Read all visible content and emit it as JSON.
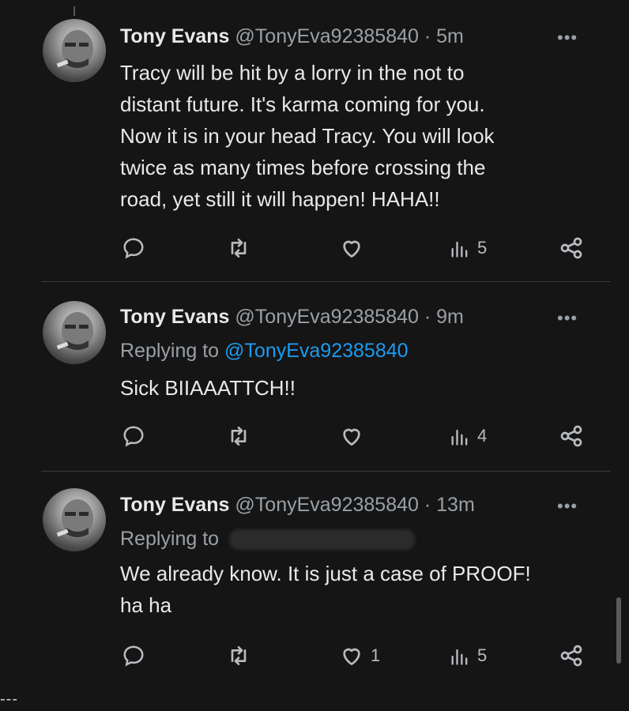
{
  "tweets": [
    {
      "name": "Tony Evans",
      "handle": "@TonyEva92385840",
      "time": "· 5m",
      "replying_label": "",
      "replying_to": "",
      "text_lines": [
        "Tracy will be hit by a lorry in the not to",
        "distant future. It's karma coming for you.",
        "Now it is in your head Tracy. You will look",
        "twice as many times before crossing the",
        "road, yet still it will  happen!  HAHA!!"
      ],
      "likes": "",
      "views": "5"
    },
    {
      "name": "Tony Evans",
      "handle": "@TonyEva92385840",
      "time": "· 9m",
      "replying_label": "Replying to",
      "replying_to": "@TonyEva92385840",
      "text_lines": [
        "Sick BIIAAATTCH!!"
      ],
      "likes": "",
      "views": "4"
    },
    {
      "name": "Tony Evans",
      "handle": "@TonyEva92385840",
      "time": "· 13m",
      "replying_label": "Replying to",
      "replying_to": "",
      "text_lines": [
        "We already know. It is just a case of PROOF!",
        "ha ha"
      ],
      "likes": "1",
      "views": "5"
    }
  ],
  "more_label": "•••",
  "footer": "---",
  "icons": {
    "reply": "reply-icon",
    "retweet": "retweet-icon",
    "like": "heart-icon",
    "views": "views-icon",
    "share": "share-icon"
  },
  "colors": {
    "background": "#151515",
    "text": "#e7e9ea",
    "secondary": "#9aa0a6",
    "link": "#1d9bf0"
  }
}
